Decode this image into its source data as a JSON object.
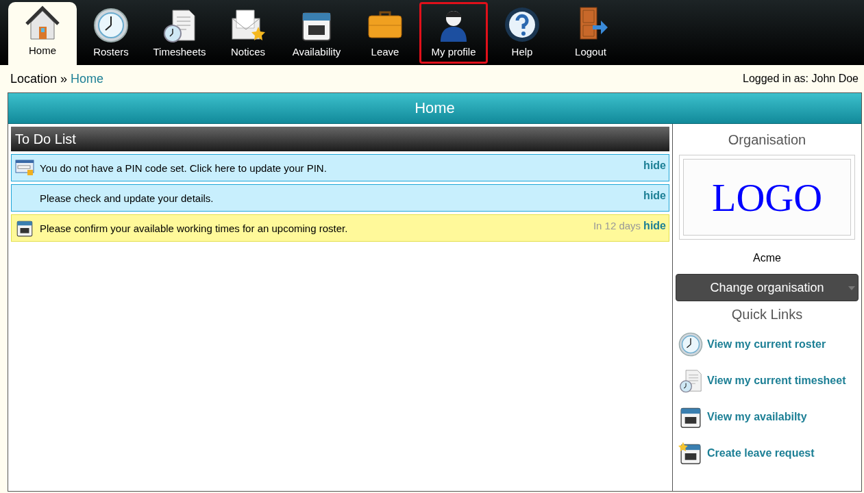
{
  "nav": [
    {
      "label": "Home",
      "kind": "house",
      "selected": true,
      "highlighted": false
    },
    {
      "label": "Rosters",
      "kind": "clock",
      "selected": false,
      "highlighted": false
    },
    {
      "label": "Timesheets",
      "kind": "timesheet",
      "selected": false,
      "highlighted": false
    },
    {
      "label": "Notices",
      "kind": "envelope",
      "selected": false,
      "highlighted": false
    },
    {
      "label": "Availability",
      "kind": "calendar",
      "selected": false,
      "highlighted": false
    },
    {
      "label": "Leave",
      "kind": "briefcase",
      "selected": false,
      "highlighted": false
    },
    {
      "label": "My profile",
      "kind": "person",
      "selected": false,
      "highlighted": true
    },
    {
      "label": "Help",
      "kind": "help",
      "selected": false,
      "highlighted": false
    },
    {
      "label": "Logout",
      "kind": "door",
      "selected": false,
      "highlighted": false
    }
  ],
  "breadcrumb": {
    "prefix": "Location »",
    "current": "Home"
  },
  "logged_in": "Logged in as: John Doe",
  "page_title": "Home",
  "todo": {
    "title": "To Do List",
    "items": [
      {
        "text": "You do not have a PIN code set. Click here to update your PIN.",
        "kind": "pin",
        "action": "hide"
      },
      {
        "text": "Please check and update your details.",
        "kind": "details",
        "action": "hide"
      },
      {
        "text": "Please confirm your available working times for an upcoming roster.",
        "kind": "availability",
        "due": "In 12 days",
        "action": "hide"
      }
    ]
  },
  "sidebar": {
    "organisation_title": "Organisation",
    "logo_text": "LOGO",
    "organisation_name": "Acme",
    "change_button": "Change organisation",
    "quick_links_title": "Quick Links",
    "links": [
      {
        "label": "View my current roster",
        "kind": "clock"
      },
      {
        "label": "View my current timesheet",
        "kind": "timesheet"
      },
      {
        "label": "View my availabilty",
        "kind": "calendar"
      },
      {
        "label": "Create leave request",
        "kind": "leave"
      }
    ]
  }
}
